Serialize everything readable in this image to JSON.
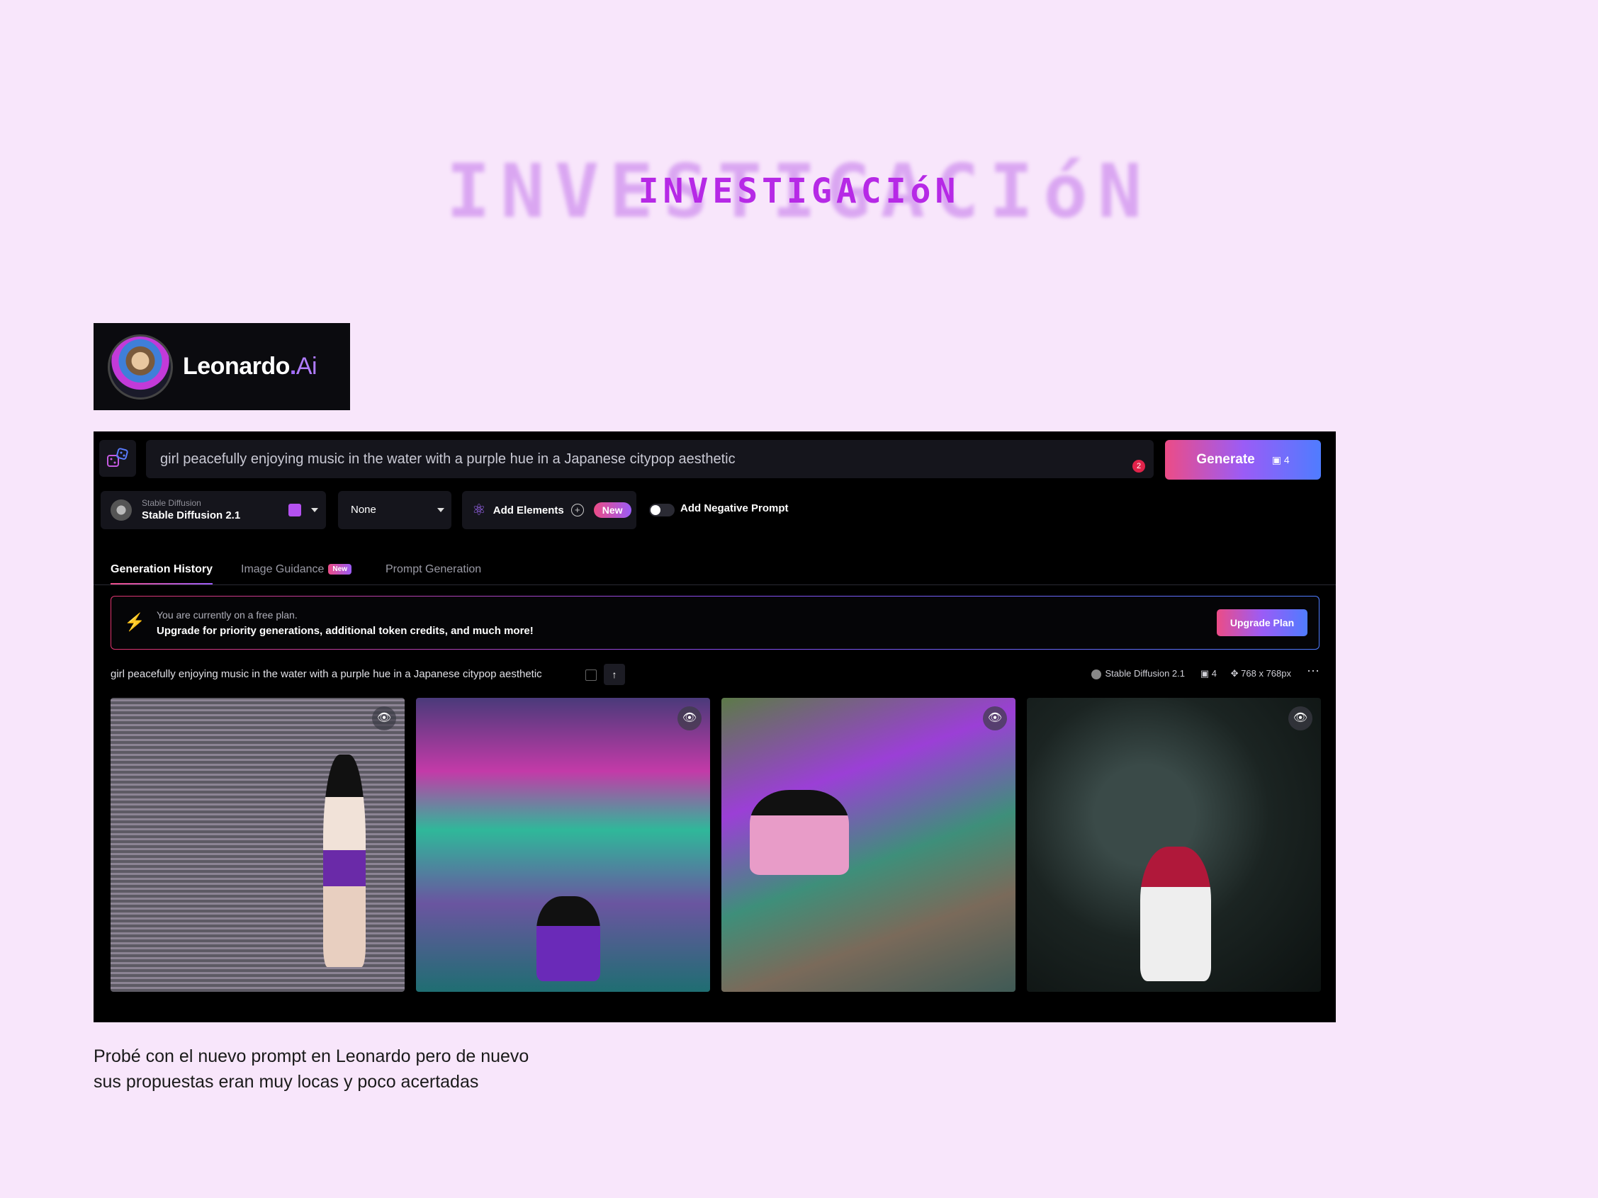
{
  "heading": {
    "blurred": "INVESTIGACIóN",
    "main": "INVESTIGACIóN"
  },
  "logo": {
    "brand": "Leonardo",
    "dot": ".",
    "suffix": "Ai"
  },
  "app": {
    "prompt": "girl peacefully enjoying music in the water with a purple hue in a Japanese citypop aesthetic",
    "prompt_badge": "2",
    "generate_label": "Generate",
    "generate_count": "4",
    "model": {
      "sub": "Stable Diffusion",
      "name": "Stable Diffusion 2.1"
    },
    "style_select": "None",
    "add_elements": "Add Elements",
    "new_pill": "New",
    "negative_prompt": "Add Negative Prompt",
    "tabs": [
      {
        "label": "Generation History"
      },
      {
        "label": "Image Guidance",
        "badge": "New"
      },
      {
        "label": "Prompt Generation"
      }
    ],
    "upgrade": {
      "line1": "You are currently on a free plan.",
      "line2": "Upgrade for priority generations, additional token credits, and much more!",
      "button": "Upgrade Plan"
    },
    "generation": {
      "prompt": "girl peacefully enjoying music in the water with a purple hue in a Japanese citypop aesthetic",
      "model": "Stable Diffusion 2.1",
      "count": "4",
      "size": "768 x 768px"
    }
  },
  "caption": {
    "line1": "Probé con el nuevo prompt en Leonardo pero de nuevo",
    "line2": "sus propuestas eran muy locas y poco acertadas"
  }
}
